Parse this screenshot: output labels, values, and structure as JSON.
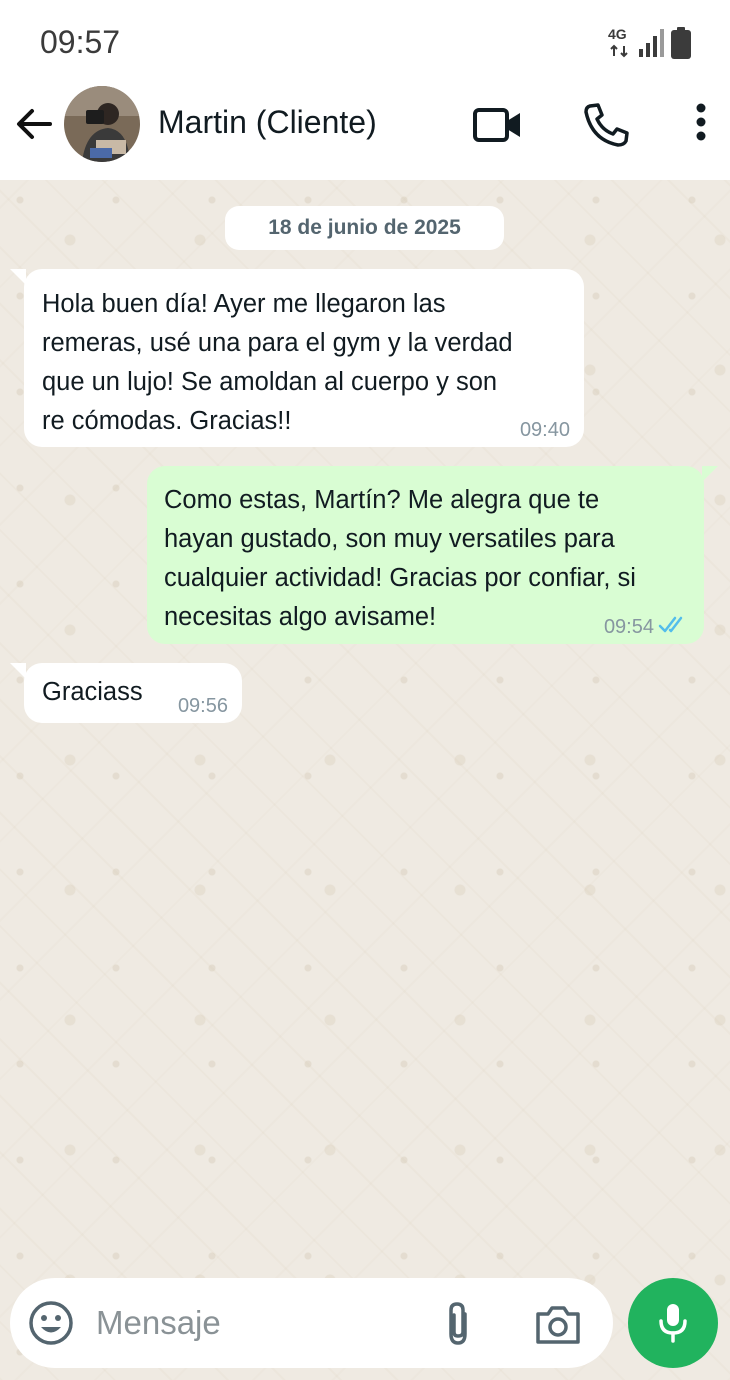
{
  "status_bar": {
    "time": "09:57",
    "network_label": "4G",
    "icons": [
      "network-4g-icon",
      "signal-icon",
      "battery-icon"
    ]
  },
  "header": {
    "contact_name": "Martin (Cliente)",
    "icons": [
      "back-arrow-icon",
      "avatar",
      "video-call-icon",
      "phone-call-icon",
      "more-options-icon"
    ]
  },
  "chat": {
    "date_label": "18 de junio de 2025",
    "messages": [
      {
        "direction": "incoming",
        "text": "Hola buen día! Ayer me llegaron las\nremeras, usé una para el gym y la verdad\nque un lujo! Se amoldan al cuerpo y son\nre cómodas. Gracias!!",
        "time": "09:40"
      },
      {
        "direction": "outgoing",
        "text": "Como estas, Martín? Me alegra que te\nhayan gustado, son muy versatiles para\ncualquier actividad! Gracias por confiar, si\nnecesitas algo avisame!",
        "time": "09:54",
        "status": "read"
      },
      {
        "direction": "incoming",
        "text": "Graciass",
        "time": "09:56"
      }
    ]
  },
  "composer": {
    "placeholder": "Mensaje",
    "icons": [
      "emoji-icon",
      "attach-icon",
      "camera-icon",
      "mic-icon"
    ]
  },
  "colors": {
    "incoming_bubble": "#ffffff",
    "outgoing_bubble": "#d9fdd3",
    "read_ticks": "#53bdeb",
    "mic_button": "#21b35e",
    "chat_background": "#efeae2"
  }
}
